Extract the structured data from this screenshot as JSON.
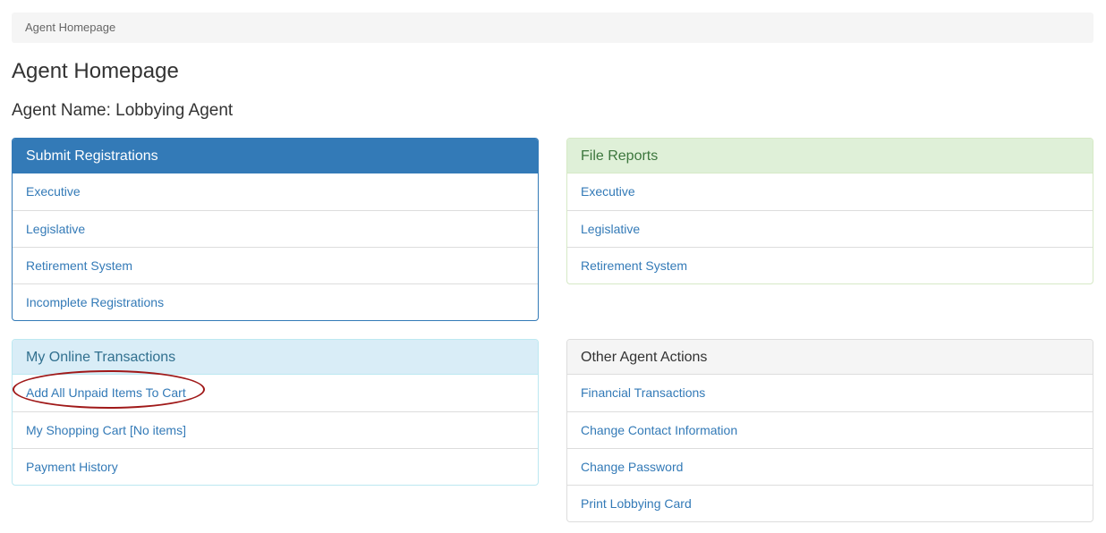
{
  "breadcrumb": {
    "current": "Agent Homepage"
  },
  "page": {
    "title": "Agent Homepage",
    "agent_name": "Agent Name: Lobbying Agent"
  },
  "panels": {
    "submit_registrations": {
      "title": "Submit Registrations",
      "items": [
        "Executive",
        "Legislative",
        "Retirement System",
        "Incomplete Registrations"
      ]
    },
    "file_reports": {
      "title": "File Reports",
      "items": [
        "Executive",
        "Legislative",
        "Retirement System"
      ]
    },
    "online_transactions": {
      "title": "My Online Transactions",
      "items": [
        "Add All Unpaid Items To Cart",
        "My Shopping Cart [No items]",
        "Payment History"
      ]
    },
    "other_actions": {
      "title": "Other Agent Actions",
      "items": [
        "Financial Transactions",
        "Change Contact Information",
        "Change Password",
        "Print Lobbying Card"
      ]
    }
  },
  "colors": {
    "primary": "#337ab7",
    "success_bg": "#dff0d8",
    "info_bg": "#d9edf7",
    "link": "#337ab7",
    "annotation": "#a01919"
  }
}
